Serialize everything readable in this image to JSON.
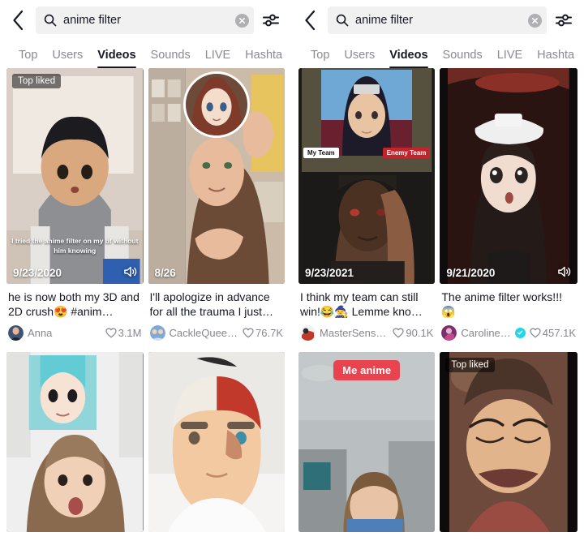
{
  "panels": [
    {
      "header": {
        "back_icon": "chevron-left-icon",
        "search_icon": "search-icon",
        "search_value": "anime filter",
        "search_placeholder": "Search",
        "clear_icon": "close-circle-icon",
        "filter_icon": "sliders-icon"
      },
      "tabs": [
        {
          "label": "Top",
          "active": false
        },
        {
          "label": "Users",
          "active": false
        },
        {
          "label": "Videos",
          "active": true
        },
        {
          "label": "Sounds",
          "active": false
        },
        {
          "label": "LIVE",
          "active": false
        },
        {
          "label": "Hashta",
          "active": false
        }
      ],
      "videos": [
        {
          "badge": "Top liked",
          "badge_style": "dark",
          "date": "9/23/2020",
          "has_sound": true,
          "subtitle": "I tried the anime filter on my bf without him knowing",
          "caption": "he is now both my 3D and 2D crush😍 #anim…",
          "author": "Anna",
          "verified": false,
          "likes": "3.1M"
        },
        {
          "badge": "",
          "badge_style": "none",
          "date": "8/26",
          "has_sound": false,
          "subtitle": "",
          "caption": "I'll apologize in advance for all the trauma I just…",
          "author": "CackleQuee…",
          "verified": false,
          "likes": "76.7K"
        },
        {
          "badge": "",
          "badge_style": "none",
          "date": "",
          "has_sound": false,
          "subtitle": "",
          "caption": "",
          "author": "",
          "verified": false,
          "likes": ""
        },
        {
          "badge": "",
          "badge_style": "none",
          "date": "",
          "has_sound": false,
          "subtitle": "",
          "caption": "",
          "author": "",
          "verified": false,
          "likes": ""
        }
      ]
    },
    {
      "header": {
        "back_icon": "chevron-left-icon",
        "search_icon": "search-icon",
        "search_value": "anime filter",
        "search_placeholder": "Search",
        "clear_icon": "close-circle-icon",
        "filter_icon": "sliders-icon"
      },
      "tabs": [
        {
          "label": "Top",
          "active": false
        },
        {
          "label": "Users",
          "active": false
        },
        {
          "label": "Videos",
          "active": true
        },
        {
          "label": "Sounds",
          "active": false
        },
        {
          "label": "LIVE",
          "active": false
        },
        {
          "label": "Hashta",
          "active": false
        }
      ],
      "videos": [
        {
          "badge": "",
          "badge_style": "none",
          "date": "9/23/2021",
          "has_sound": false,
          "subtitle": "",
          "team_mine": "My Team",
          "team_enemy": "Enemy Team",
          "caption": "I think my team can still win!😂🧙 Lemme kno…",
          "author": "MasterSens…",
          "verified": false,
          "likes": "90.1K"
        },
        {
          "badge": "",
          "badge_style": "none",
          "date": "9/21/2020",
          "has_sound": true,
          "subtitle": "",
          "caption": "The anime filter works!!! 😱",
          "author": "Caroline…",
          "verified": true,
          "likes": "457.1K"
        },
        {
          "badge": "Me anime",
          "badge_style": "red",
          "date": "",
          "has_sound": false,
          "subtitle": "",
          "caption": "",
          "author": "",
          "verified": false,
          "likes": ""
        },
        {
          "badge": "Top liked",
          "badge_style": "dark",
          "date": "",
          "has_sound": false,
          "subtitle": "",
          "caption": "",
          "author": "",
          "verified": false,
          "likes": ""
        }
      ]
    }
  ],
  "colors": {
    "accent_red": "#e8434e",
    "verified_blue": "#20d5ec",
    "text_primary": "#161823",
    "text_secondary": "#86878b",
    "search_bg": "#f1f1f2"
  }
}
